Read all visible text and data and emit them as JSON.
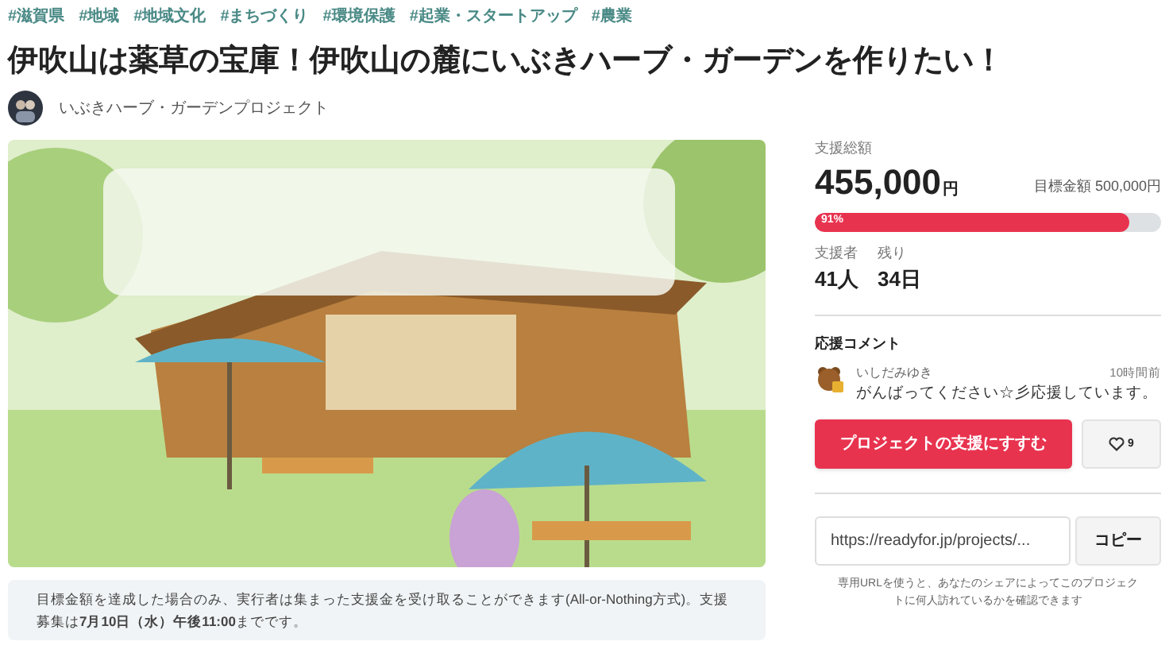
{
  "tags": [
    "#滋賀県",
    "#地域",
    "#地域文化",
    "#まちづくり",
    "#環境保護",
    "#起業・スタートアップ",
    "#農業"
  ],
  "title": "伊吹山は薬草の宝庫！伊吹山の麓にいぶきハーブ・ガーデンを作りたい！",
  "author": {
    "name": "いぶきハーブ・ガーデンプロジェクト"
  },
  "notice": "目標金額を達成した場合のみ、実行者は集まった支援金を受け取ることができます(All-or-Nothing方式)。支援募集は**7月10日（水）午後11:00**までです。",
  "stats": {
    "total_label": "支援総額",
    "total": "455,000",
    "total_unit": "円",
    "goal": "目標金額 500,000円",
    "progress": {
      "level": 0.91,
      "label": "91%"
    },
    "supporters_label": "支援者",
    "supporters": "41人",
    "remaining_label": "残り",
    "remaining": "34日"
  },
  "comments": {
    "heading": "応援コメント",
    "items": [
      {
        "user": "いしだみゆき",
        "time": "10時間前",
        "text": "がんばってください☆彡応援しています。"
      }
    ]
  },
  "support_button": "プロジェクトの支援にすすむ",
  "like_count": "9",
  "share": {
    "url": "https://readyfor.jp/projects/...",
    "copy": "コピー",
    "note": "専用URLを使うと、あなたのシェアによってこのプロジェクトに何人訪れているかを確認できます"
  }
}
